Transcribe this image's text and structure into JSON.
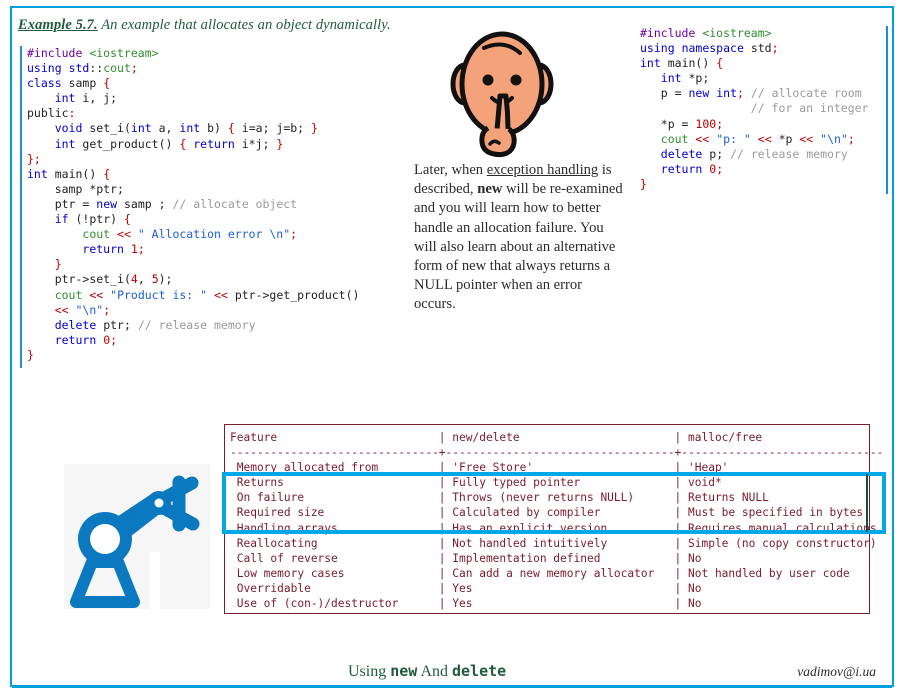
{
  "slide": {
    "title_prefix": "Example 5.7.",
    "title_rest": " An example that allocates an object dynamically.",
    "border_color": "#00a0df",
    "accent_green": "#1f5c3d",
    "highlight_color": "#00a8e8",
    "table_border_color": "#7b1b2b"
  },
  "code_left": {
    "lines": [
      "#include <iostream>",
      "using std::cout;",
      "class samp {",
      "    int i, j;",
      "public:",
      "    void set_i(int a, int b) { i=a; j=b; }",
      "    int get_product() { return i*j; }",
      "};",
      "int main() {",
      "    samp *ptr;",
      "    ptr = new samp ; // allocate object",
      "    if (!ptr) {",
      "        cout << \" Allocation error \\n\";",
      "        return 1;",
      "    }",
      "    ptr->set_i(4, 5);",
      "    cout << \"Product is: \" << ptr->get_product()",
      "    << \"\\n\";",
      "    delete ptr; // release memory",
      "    return 0;",
      "}"
    ]
  },
  "code_right": {
    "lines": [
      "#include <iostream>",
      "using namespace std;",
      "int main() {",
      "   int *p;",
      "   p = new int; // allocate room",
      "                // for an integer",
      "   *p = 100;",
      "   cout << \"p: \" << *p << \"\\n\";",
      "   delete p; // release memory",
      "   return 0;",
      "}"
    ]
  },
  "paragraph": {
    "part1": "Later, when ",
    "link": "exception handling",
    "part2": " is described, ",
    "bold": "new",
    "part3": " will be re-examined and you will learn how to better handle an allocation failure. You will also learn about an alternative form of new that always returns a NULL pointer when an error occurs."
  },
  "table": {
    "headers": [
      "Feature",
      "new/delete",
      "malloc/free"
    ],
    "separator": "-",
    "rows": [
      {
        "feature": "Memory allocated from",
        "new_delete": "'Free Store'",
        "malloc_free": "'Heap'"
      },
      {
        "feature": "Returns",
        "new_delete": "Fully typed pointer",
        "malloc_free": "void*"
      },
      {
        "feature": "On failure",
        "new_delete": "Throws (never returns NULL)",
        "malloc_free": "Returns NULL"
      },
      {
        "feature": "Required size",
        "new_delete": "Calculated by compiler",
        "malloc_free": "Must be specified in bytes"
      },
      {
        "feature": "Handling arrays",
        "new_delete": "Has an explicit version",
        "malloc_free": "Requires manual calculations"
      },
      {
        "feature": "Reallocating",
        "new_delete": "Not handled intuitively",
        "malloc_free": "Simple (no copy constructor)"
      },
      {
        "feature": "Call of reverse",
        "new_delete": "Implementation defined",
        "malloc_free": "No"
      },
      {
        "feature": "Low memory cases",
        "new_delete": "Can add a new memory allocator",
        "malloc_free": "Not handled by user code"
      },
      {
        "feature": "Overridable",
        "new_delete": "Yes",
        "malloc_free": "No"
      },
      {
        "feature": "Use of (con-)/destructor",
        "new_delete": "Yes",
        "malloc_free": "No"
      }
    ],
    "highlighted_rows": [
      1,
      2,
      3,
      4
    ]
  },
  "footer": {
    "title_part1": "Using ",
    "title_kw1": "new",
    "title_part2": " And ",
    "title_kw2": "delete",
    "email": "vadimov@i.ua"
  },
  "clipart": {
    "face": "shushing-face-icon",
    "robot": "robot-arm-icon"
  }
}
